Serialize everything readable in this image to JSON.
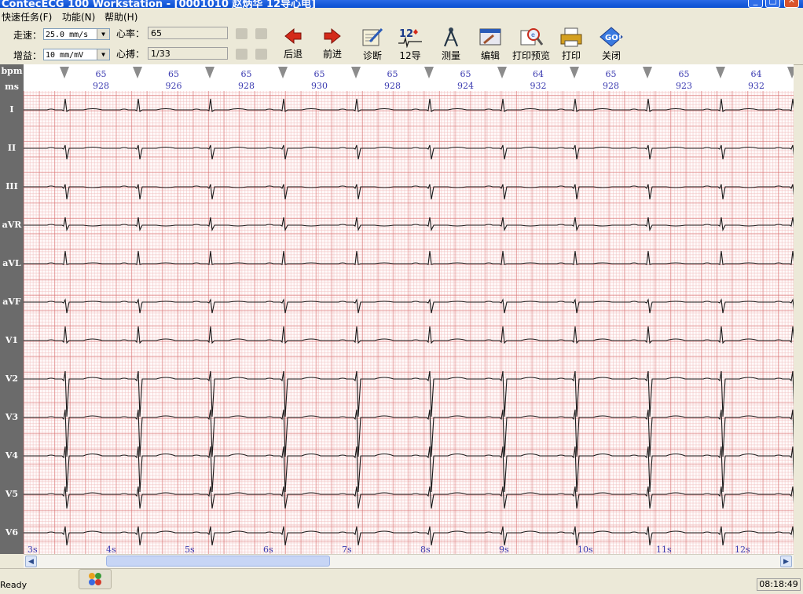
{
  "window": {
    "title": "ContecECG 100 Workstation - [0001010 赵炳华 12导心电]"
  },
  "menu": [
    "快速任务(F)",
    "功能(N)",
    "帮助(H)"
  ],
  "settings": {
    "speed_label": "走速：",
    "speed_value": "25.0 mm/s",
    "gain_label": "增益：",
    "gain_value": "10 mm/mV",
    "hr_label": "心率：",
    "hr_value": "65",
    "beat_label": "心搏：",
    "beat_value": "1/33"
  },
  "toolbar": [
    "后退",
    "前进",
    "诊断",
    "12导",
    "测量",
    "编辑",
    "打印预览",
    "打印",
    "关闭"
  ],
  "header": {
    "bpm_label": "bpm",
    "ms_label": "ms",
    "beats": [
      {
        "bpm": "65",
        "ms": "928"
      },
      {
        "bpm": "65",
        "ms": "926"
      },
      {
        "bpm": "65",
        "ms": "928"
      },
      {
        "bpm": "65",
        "ms": "930"
      },
      {
        "bpm": "65",
        "ms": "928"
      },
      {
        "bpm": "65",
        "ms": "924"
      },
      {
        "bpm": "64",
        "ms": "932"
      },
      {
        "bpm": "65",
        "ms": "928"
      },
      {
        "bpm": "65",
        "ms": "923"
      },
      {
        "bpm": "64",
        "ms": "932"
      }
    ]
  },
  "leads": [
    "I",
    "II",
    "III",
    "aVR",
    "aVL",
    "aVF",
    "V1",
    "V2",
    "V3",
    "V4",
    "V5",
    "V6"
  ],
  "time_labels": [
    "3s",
    "4s",
    "5s",
    "6s",
    "7s",
    "8s",
    "9s",
    "10s",
    "11s",
    "12s"
  ],
  "status": {
    "text": "Ready",
    "clock": "08:18:49"
  },
  "colors": {
    "grid_major": "#d76e6e",
    "grid_minor": "#f0bebe",
    "trace": "#1a1a1a",
    "annotation": "#3a3ab0"
  }
}
